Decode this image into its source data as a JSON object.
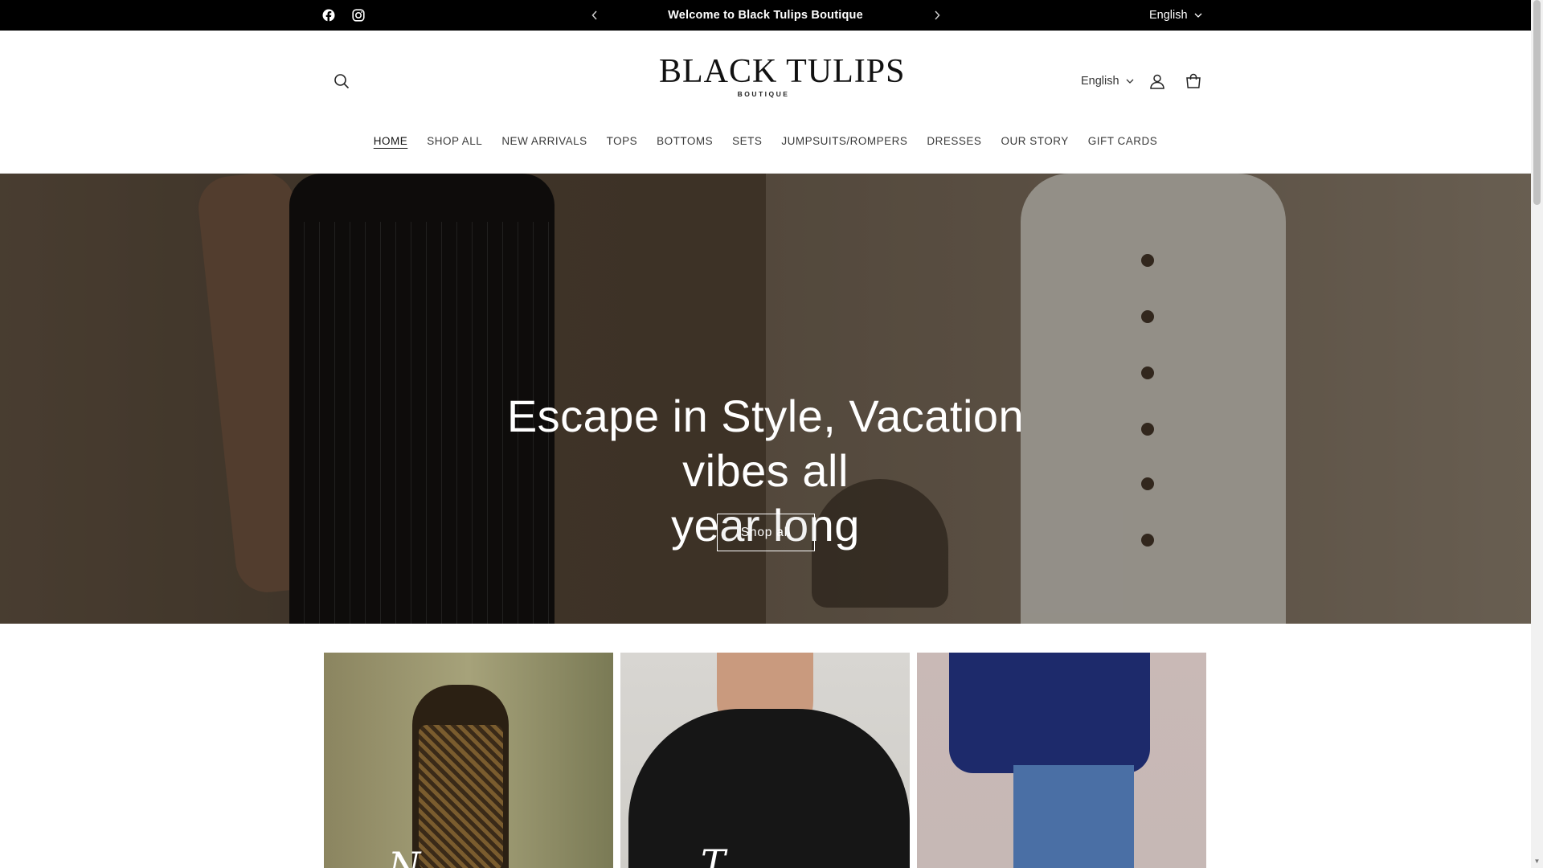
{
  "announcement": {
    "message": "Welcome to Black Tulips Boutique",
    "prev_icon": "chevron-left-icon",
    "next_icon": "chevron-right-icon",
    "language": "English",
    "social": [
      "facebook-icon",
      "instagram-icon"
    ]
  },
  "header": {
    "logo_main": "BLACK TULIPS",
    "logo_sub": "BOUTIQUE",
    "language": "English",
    "icons": [
      "search-icon",
      "account-icon",
      "cart-icon"
    ]
  },
  "nav": {
    "items": [
      {
        "label": "HOME"
      },
      {
        "label": "SHOP ALL"
      },
      {
        "label": "NEW ARRIVALS"
      },
      {
        "label": "TOPS"
      },
      {
        "label": "BOTTOMS"
      },
      {
        "label": "SETS"
      },
      {
        "label": "JUMPSUITS/ROMPERS"
      },
      {
        "label": "DRESSES"
      },
      {
        "label": "OUR STORY"
      },
      {
        "label": "GIFT CARDS"
      }
    ],
    "active": "HOME"
  },
  "hero": {
    "headline_line1": "Escape in Style, Vacation vibes all",
    "headline_line2": "year long",
    "cta_label": "Shop all"
  },
  "collections": {
    "cards": [
      {
        "script": "N"
      },
      {
        "script": "T"
      },
      {
        "script": ""
      }
    ]
  },
  "colors": {
    "announcement_bg": "#000000",
    "page_bg": "#ffffff",
    "text": "#222222"
  }
}
